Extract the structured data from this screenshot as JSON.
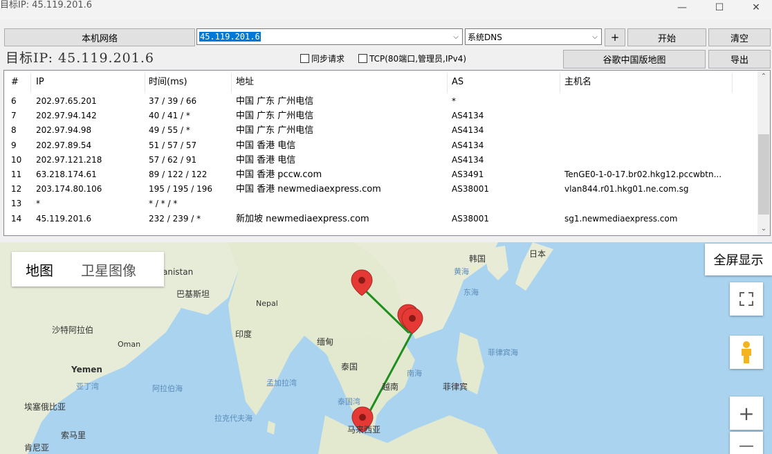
{
  "window": {
    "title": "目标IP: 45.119.201.6",
    "minimize": "—",
    "maximize": "☐",
    "close": "✕"
  },
  "toolbar": {
    "local_network": "本机网络",
    "ip_value": "45.119.201.6",
    "dns_value": "系统DNS",
    "plus": "+",
    "start": "开始",
    "clear": "清空",
    "target_label": "目标IP: 45.119.201.6",
    "sync_request": "同步请求",
    "tcp_option": "TCP(80端口,管理员,IPv4)",
    "google_map": "谷歌中国版地图",
    "export": "导出"
  },
  "table": {
    "headers": [
      "#",
      "IP",
      "时间(ms)",
      "地址",
      "AS",
      "主机名"
    ],
    "rows": [
      {
        "n": "6",
        "ip": "202.97.65.201",
        "time": "37 / 39 / 66",
        "addr": "中国 广东 广州电信",
        "as": "*",
        "host": ""
      },
      {
        "n": "7",
        "ip": "202.97.94.142",
        "time": "40 / 41 / *",
        "addr": "中国 广东 广州电信",
        "as": "AS4134",
        "host": ""
      },
      {
        "n": "8",
        "ip": "202.97.94.98",
        "time": "49 / 55 / *",
        "addr": "中国 广东 广州电信",
        "as": "AS4134",
        "host": ""
      },
      {
        "n": "9",
        "ip": "202.97.89.54",
        "time": "51 / 57 / 57",
        "addr": "中国 香港 电信",
        "as": "AS4134",
        "host": ""
      },
      {
        "n": "10",
        "ip": "202.97.121.218",
        "time": "57 / 62 / 91",
        "addr": "中国 香港 电信",
        "as": "AS4134",
        "host": ""
      },
      {
        "n": "11",
        "ip": "63.218.174.61",
        "time": "89 / 122 / 122",
        "addr": "中国 香港 pccw.com",
        "as": "AS3491",
        "host": "TenGE0-1-0-17.br02.hkg12.pccwbtn..."
      },
      {
        "n": "12",
        "ip": "203.174.80.106",
        "time": "195 / 195 / 196",
        "addr": "中国 香港 newmediaexpress.com",
        "as": "AS38001",
        "host": "vlan844.r01.hkg01.ne.com.sg"
      },
      {
        "n": "13",
        "ip": "*",
        "time": "* / * / *",
        "addr": "",
        "as": "",
        "host": ""
      },
      {
        "n": "14",
        "ip": "45.119.201.6",
        "time": "232 / 239 / *",
        "addr": "新加坡 newmediaexpress.com",
        "as": "AS38001",
        "host": "sg1.newmediaexpress.com"
      }
    ]
  },
  "map": {
    "map_tab": "地图",
    "satellite_tab": "卫星图像",
    "fullscreen": "全屏显示",
    "zoom_in": "+",
    "zoom_out": "—",
    "labels": {
      "afghanistan": "anistan",
      "pakistan": "巴基斯坦",
      "nepal": "Nepal",
      "india": "印度",
      "saudi": "沙特阿拉伯",
      "oman": "Oman",
      "yemen": "Yemen",
      "myanmar": "缅甸",
      "thailand": "泰国",
      "vietnam": "越南",
      "philippines": "菲律宾",
      "korea": "韩国",
      "japan": "日本",
      "malaysia": "马来西亚",
      "ethiopia": "埃塞俄比亚",
      "somalia": "索马里",
      "kenya": "肯尼亚"
    },
    "seas": {
      "yellow_sea": "黄海",
      "east_sea": "东海",
      "philippine_sea": "菲律宾海",
      "south_sea": "南海",
      "gulf_thailand": "泰国湾",
      "bay_bengal": "孟加拉湾",
      "arabian_sea": "阿拉伯海",
      "gulf_aden": "亚丁湾",
      "laccadive": "拉克代夫海"
    },
    "colors": {
      "route": "#1e8f1e",
      "marker": "#e53935"
    }
  }
}
